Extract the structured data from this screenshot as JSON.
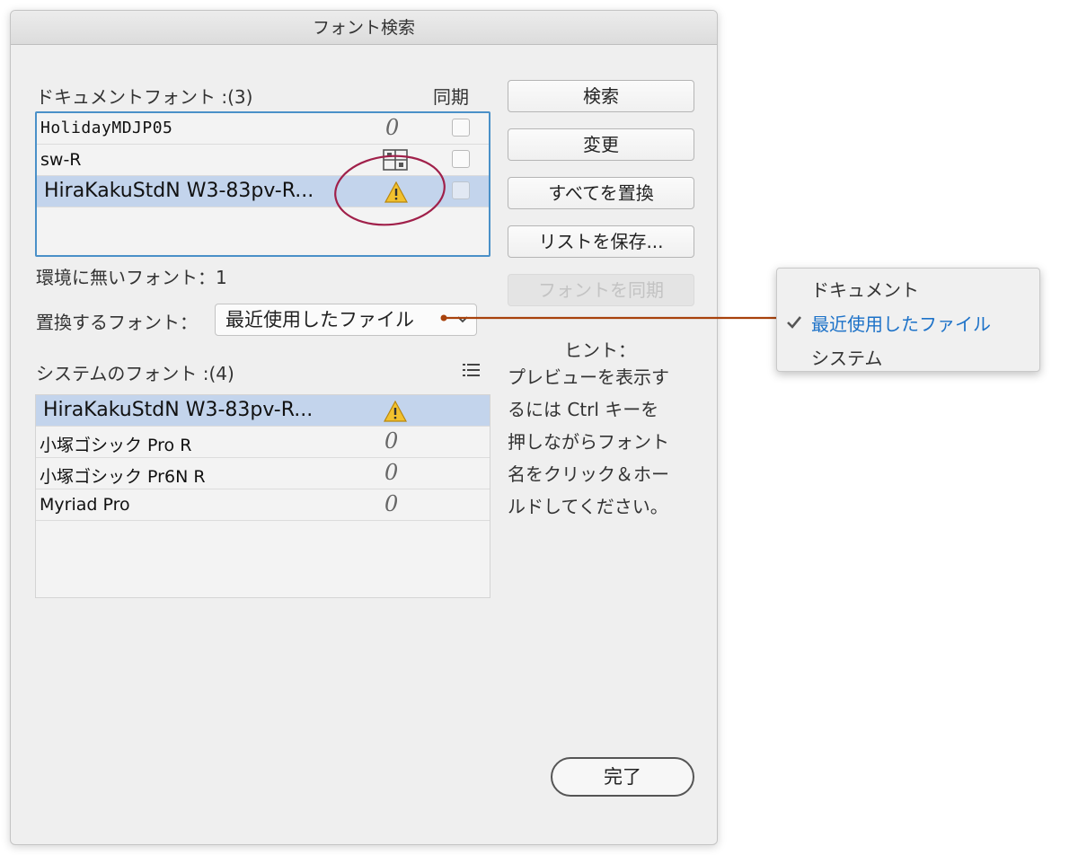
{
  "dialog": {
    "title": "フォント検索",
    "document_fonts_label": "ドキュメントフォント :(3)",
    "sync_label": "同期",
    "missing_label": "環境に無いフォント：1",
    "replace_label": "置換するフォント：",
    "replace_select_value": "最近使用したファイル",
    "system_fonts_label": "システムのフォント :(4)"
  },
  "document_fonts": [
    {
      "name": "HolidayMDJP05",
      "icon": "opentype-icon",
      "synced": false
    },
    {
      "name": "sw-R",
      "icon": "missing-font-icon",
      "synced": false
    },
    {
      "name": "HiraKakuStdN W3-83pv-R...",
      "icon": "warning-icon",
      "synced": false,
      "selected": true
    }
  ],
  "system_fonts": [
    {
      "name": "HiraKakuStdN W3-83pv-R...",
      "icon": "warning-icon",
      "selected": true
    },
    {
      "name": "小塚ゴシック Pro R",
      "icon": "opentype-icon"
    },
    {
      "name": "小塚ゴシック Pr6N R",
      "icon": "opentype-icon"
    },
    {
      "name": "Myriad Pro",
      "icon": "opentype-icon"
    }
  ],
  "buttons": {
    "search": "検索",
    "change": "変更",
    "replace_all": "すべてを置換",
    "save_list": "リストを保存...",
    "sync_fonts": "フォントを同期",
    "done": "完了"
  },
  "hint": {
    "title": "ヒント：",
    "lines": [
      "プレビューを表示す",
      "るには Ctrl キーを",
      "押しながらフォント",
      "名をクリック＆ホー",
      "ルドしてください。"
    ]
  },
  "popup": {
    "items": [
      "ドキュメント",
      "最近使用したファイル",
      "システム"
    ],
    "checked_item": "最近使用したファイル"
  },
  "colors": {
    "accent": "#1d72c8",
    "selection": "#c3d4ec",
    "annotation_circle": "#a0204a",
    "connector_line": "#a8420c",
    "warning": "#f2c12e"
  }
}
